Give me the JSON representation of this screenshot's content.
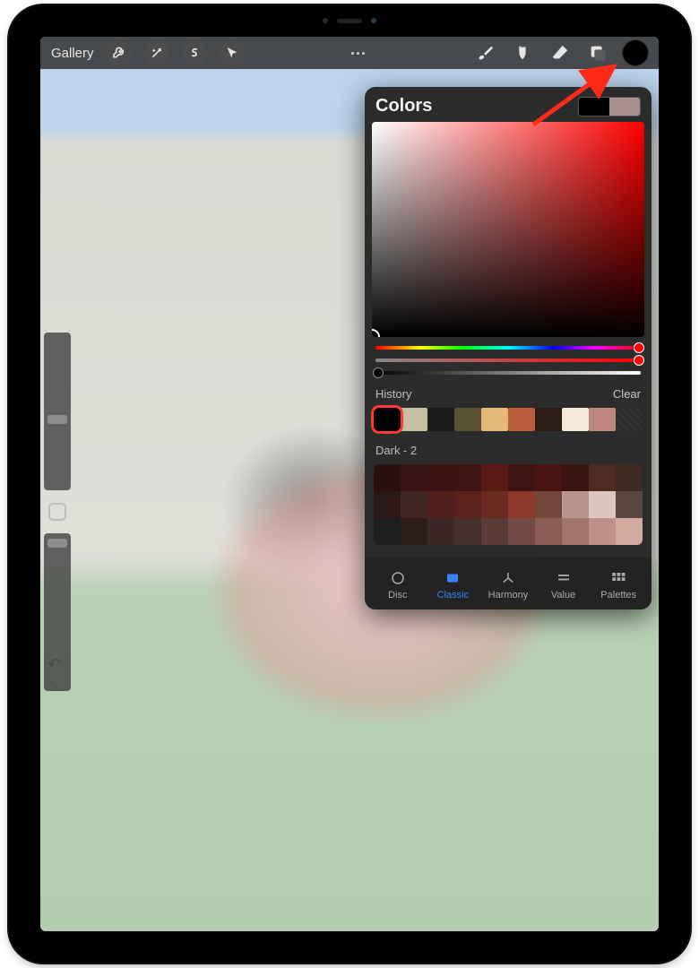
{
  "topbar": {
    "gallery_label": "Gallery"
  },
  "colors_panel": {
    "title": "Colors",
    "preview_primary": "#000000",
    "preview_secondary": "#a88e8e",
    "history_label": "History",
    "clear_label": "Clear",
    "history": [
      "#000000",
      "#c7bfa3",
      "#1a1a1a",
      "#585237",
      "#e4b977",
      "#b85c3c",
      "#2c1c15",
      "#f5ead8",
      "#bd8880"
    ],
    "palette_name": "Dark - 2",
    "palette": [
      [
        "#2b1010",
        "#3a1414",
        "#3a1212",
        "#3f1312",
        "#5a1a15",
        "#3f1310",
        "#4a1410",
        "#3a1410",
        "#4d2c1f",
        "#3e2a22"
      ],
      [
        "#2a1916",
        "#402724",
        "#52201a",
        "#5a221a",
        "#6a2a20",
        "#8e3a2a",
        "#72473a",
        "#b9968c",
        "#dcc7bf",
        "#5a4740"
      ],
      [
        "#1e1e1e",
        "#2c1d1b",
        "#3a2624",
        "#43302e",
        "#5a3c38",
        "#734a44",
        "#8c5d55",
        "#a3766c",
        "#bd9088",
        "#d3aaa0"
      ]
    ],
    "tabs": [
      {
        "id": "disc",
        "label": "Disc"
      },
      {
        "id": "classic",
        "label": "Classic"
      },
      {
        "id": "harmony",
        "label": "Harmony"
      },
      {
        "id": "value",
        "label": "Value"
      },
      {
        "id": "palettes",
        "label": "Palettes"
      }
    ],
    "active_tab": "classic"
  }
}
